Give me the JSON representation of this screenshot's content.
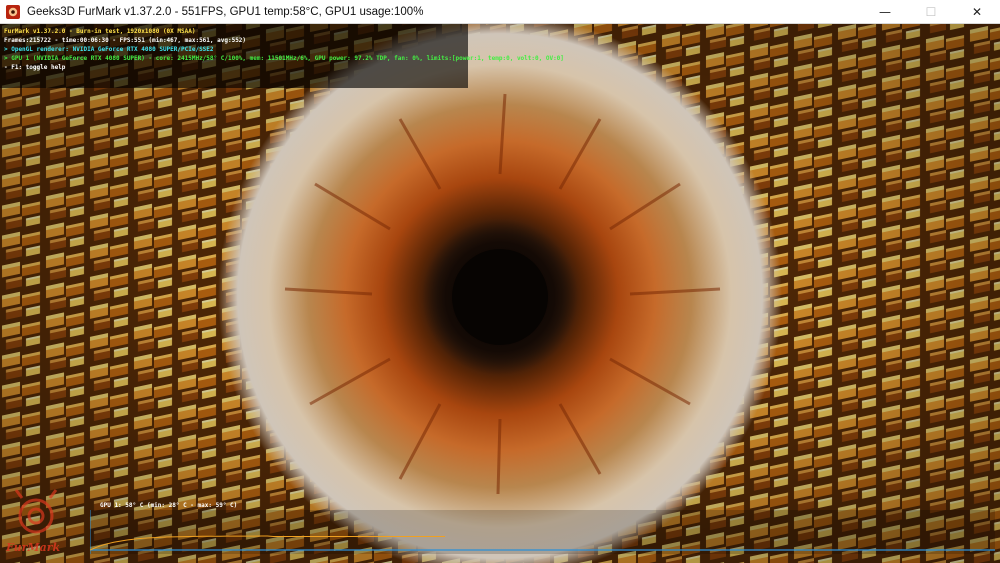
{
  "window": {
    "title": "Geeks3D FurMark v1.37.2.0 - 551FPS, GPU1 temp:58°C, GPU1 usage:100%",
    "controls": {
      "minimize": "—",
      "maximize": "☐",
      "close": "✕"
    }
  },
  "overlay": {
    "lines": [
      "FurMark v1.37.2.0 - Burn-in test, 1920x1080 (0X MSAA)",
      "Frames:215722 - time:00:06:30 - FPS:551 (min:467, max:561, avg:552)",
      "> OpenGL renderer: NVIDIA GeForce RTX 4080 SUPER/PCIe/SSE2",
      "> GPU 1 (NVIDIA GeForce RTX 4080 SUPER) - core: 2415MHz/58° C/100%, mem: 11501MHz/6%, GPU power: 97.2% TDP, fan: 0%, limits:[power:1, temp:0, volt:0, OV:0]",
      "- F1: toggle help"
    ]
  },
  "graph": {
    "label": "GPU 1: 58° C (min: 28° C - max: 59° C)",
    "min_temp": 28,
    "max_temp": 59,
    "current_temp": 58
  },
  "logo": {
    "text": "FurMark"
  },
  "colors": {
    "overlay_title": "#ffe14a",
    "overlay_gl": "#3fe6f0",
    "overlay_gpu": "#44ee44",
    "graph_line": "#f0a020",
    "graph_axis": "#2b8fd6",
    "logo": "#d9381e"
  }
}
